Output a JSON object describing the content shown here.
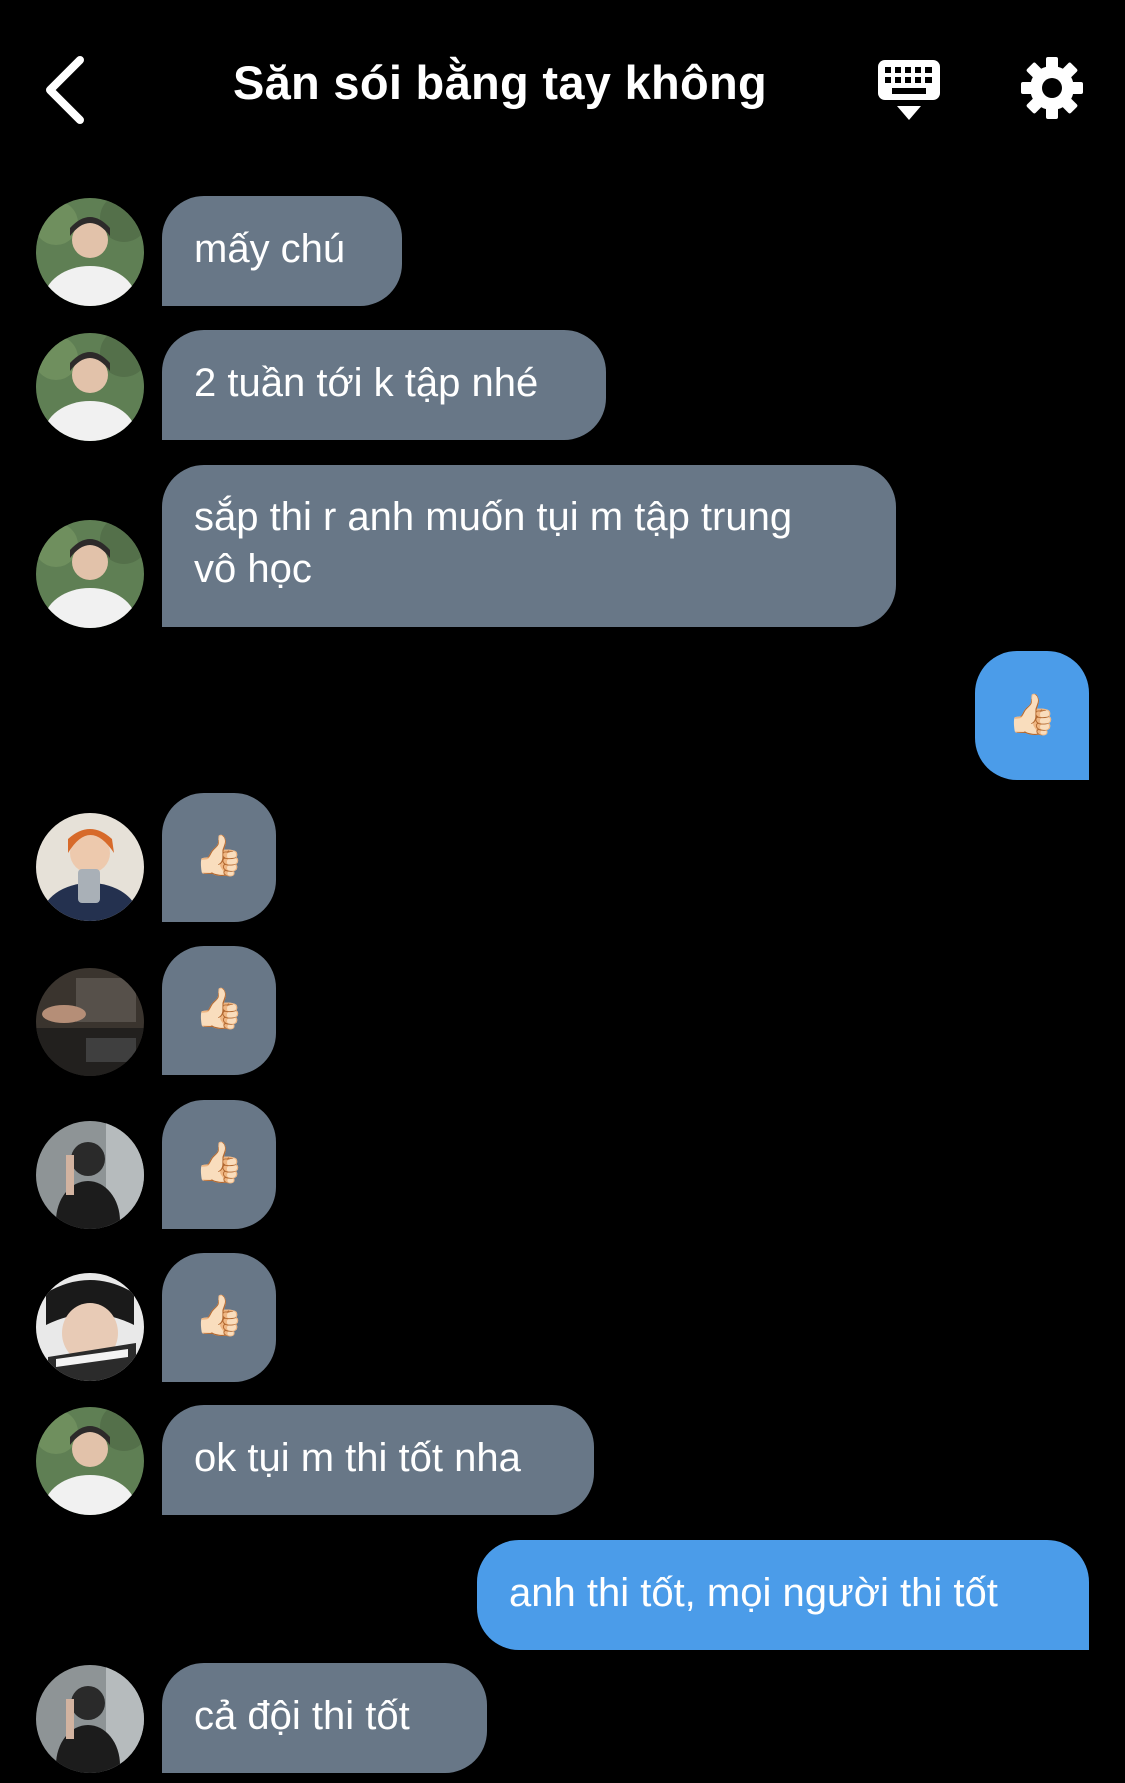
{
  "header": {
    "title": "Săn sói bằng tay không",
    "back_icon": "chevron-left-icon",
    "keyboard_icon": "keyboard-icon",
    "settings_icon": "gear-icon"
  },
  "colors": {
    "background": "#000000",
    "incoming_bubble": "#687787",
    "outgoing_bubble": "#4b9ce9",
    "text": "#ffffff"
  },
  "messages": [
    {
      "direction": "incoming",
      "sender_avatar": "avatar-1",
      "text": "mấy chú"
    },
    {
      "direction": "incoming",
      "sender_avatar": "avatar-1",
      "text": "2 tuần tới k tập nhé"
    },
    {
      "direction": "incoming",
      "sender_avatar": "avatar-1",
      "line1": "sắp thi r anh muốn tụi m tập trung",
      "line2": "vô học"
    },
    {
      "direction": "outgoing",
      "text": "👍🏻"
    },
    {
      "direction": "incoming",
      "sender_avatar": "avatar-2",
      "text": "👍🏻"
    },
    {
      "direction": "incoming",
      "sender_avatar": "avatar-3",
      "text": "👍🏻"
    },
    {
      "direction": "incoming",
      "sender_avatar": "avatar-4",
      "text": "👍🏻"
    },
    {
      "direction": "incoming",
      "sender_avatar": "avatar-5",
      "text": "👍🏻"
    },
    {
      "direction": "incoming",
      "sender_avatar": "avatar-1",
      "text": "ok tụi m thi tốt nha"
    },
    {
      "direction": "outgoing",
      "text": "anh thi tốt, mọi người thi tốt"
    },
    {
      "direction": "incoming",
      "sender_avatar": "avatar-4",
      "text": "cả đội thi tốt"
    }
  ]
}
